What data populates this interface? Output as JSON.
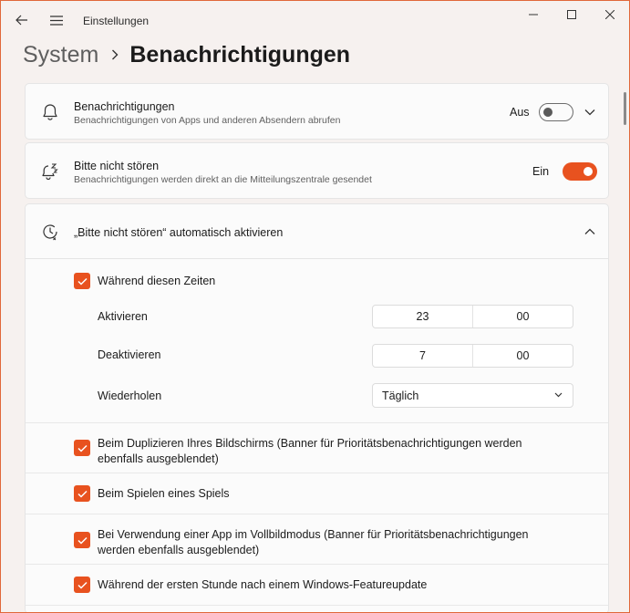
{
  "window": {
    "title": "Einstellungen"
  },
  "breadcrumb": {
    "parent": "System",
    "current": "Benachrichtigungen"
  },
  "notifications": {
    "title": "Benachrichtigungen",
    "subtitle": "Benachrichtigungen von Apps und anderen Absendern abrufen",
    "toggle_label": "Aus",
    "enabled": false,
    "icon": "bell-icon"
  },
  "dnd": {
    "title": "Bitte nicht stören",
    "subtitle": "Benachrichtigungen werden direkt an die Mitteilungszentrale gesendet",
    "toggle_label": "Ein",
    "enabled": true,
    "icon": "sleep-bell-icon"
  },
  "auto_dnd": {
    "title": "„Bitte nicht stören“ automatisch aktivieren",
    "icon": "clock-icon",
    "during_times": {
      "label": "Während diesen Zeiten",
      "checked": true,
      "activate_label": "Aktivieren",
      "activate_hour": "23",
      "activate_minute": "00",
      "deactivate_label": "Deaktivieren",
      "deactivate_hour": "7",
      "deactivate_minute": "00",
      "repeat_label": "Wiederholen",
      "repeat_value": "Täglich"
    },
    "options": [
      {
        "label": "Beim Duplizieren Ihres Bildschirms (Banner für Prioritätsbenachrichtigungen werden ebenfalls ausgeblendet)",
        "checked": true
      },
      {
        "label": "Beim Spielen eines Spiels",
        "checked": true
      },
      {
        "label": "Bei Verwendung einer App im Vollbildmodus (Banner für Prioritätsbenachrichtigungen werden ebenfalls ausgeblendet)",
        "checked": true
      },
      {
        "label": "Während der ersten Stunde nach einem Windows-Featureupdate",
        "checked": true
      }
    ]
  },
  "colors": {
    "accent": "#e8521f",
    "window_border": "#e0683a"
  }
}
